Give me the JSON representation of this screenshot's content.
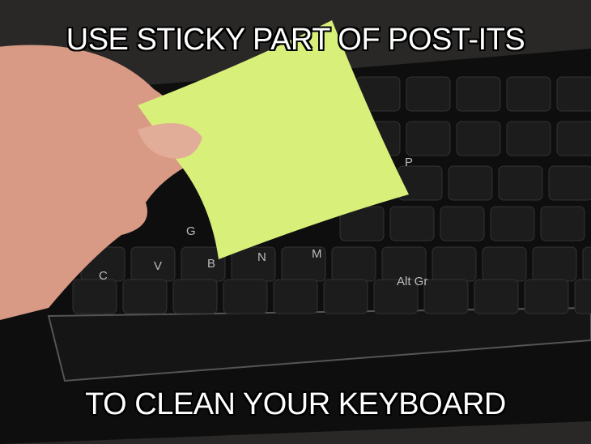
{
  "captions": {
    "top": "USE STICKY PART OF POST-ITS",
    "bottom": "TO CLEAN YOUR KEYBOARD"
  },
  "keys": [
    "G",
    "C",
    "V",
    "B",
    "N",
    "M",
    "Alt Gr",
    "P"
  ],
  "colors": {
    "note": "#d8f07a",
    "keyboard": "#0e0e0e",
    "skin": "#d89a84"
  }
}
